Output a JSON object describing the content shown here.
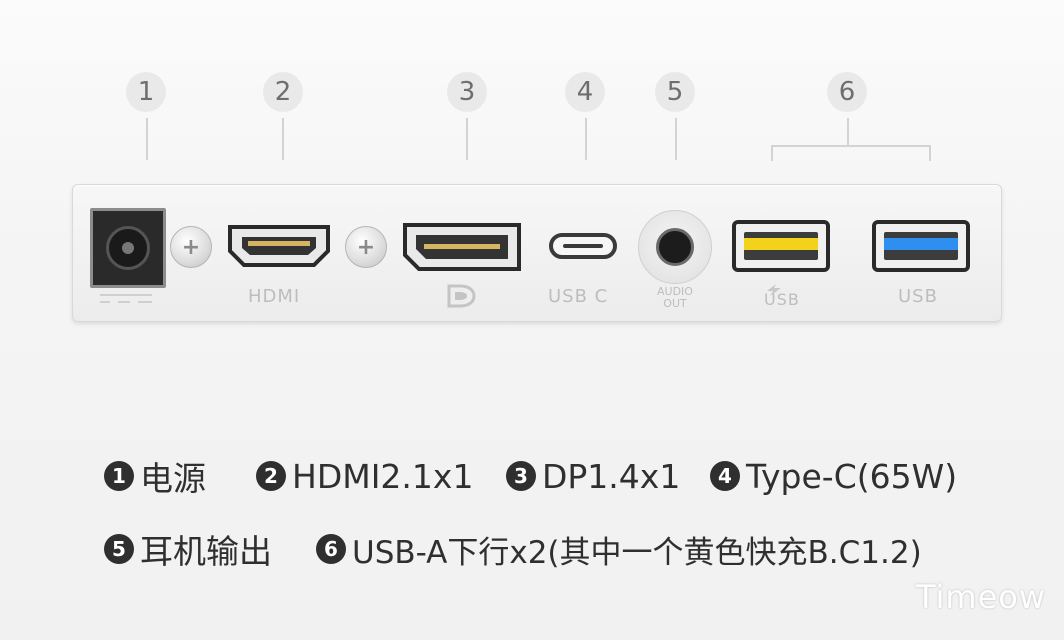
{
  "callouts": [
    "1",
    "2",
    "3",
    "4",
    "5",
    "6"
  ],
  "port_labels": {
    "hdmi": "HDMI",
    "usb_c": "USB C",
    "audio_line1": "AUDIO",
    "audio_line2": "OUT",
    "usb_fast": "USB",
    "usb": "USB"
  },
  "legend": {
    "row1": [
      {
        "num": "1",
        "text": "电源"
      },
      {
        "num": "2",
        "text": "HDMI2.1x1"
      },
      {
        "num": "3",
        "text": "DP1.4x1"
      },
      {
        "num": "4",
        "text": "Type-C(65W)"
      }
    ],
    "row2": [
      {
        "num": "5",
        "text": "耳机输出"
      },
      {
        "num": "6",
        "text": "USB-A下行x2(其中一个黄色快充B.C1.2)"
      }
    ]
  },
  "watermark": "Timeow",
  "colors": {
    "usb_fast_tongue": "#f2d21b",
    "usb3_tongue": "#2f8ff0",
    "badge": "#2f2f2f"
  }
}
